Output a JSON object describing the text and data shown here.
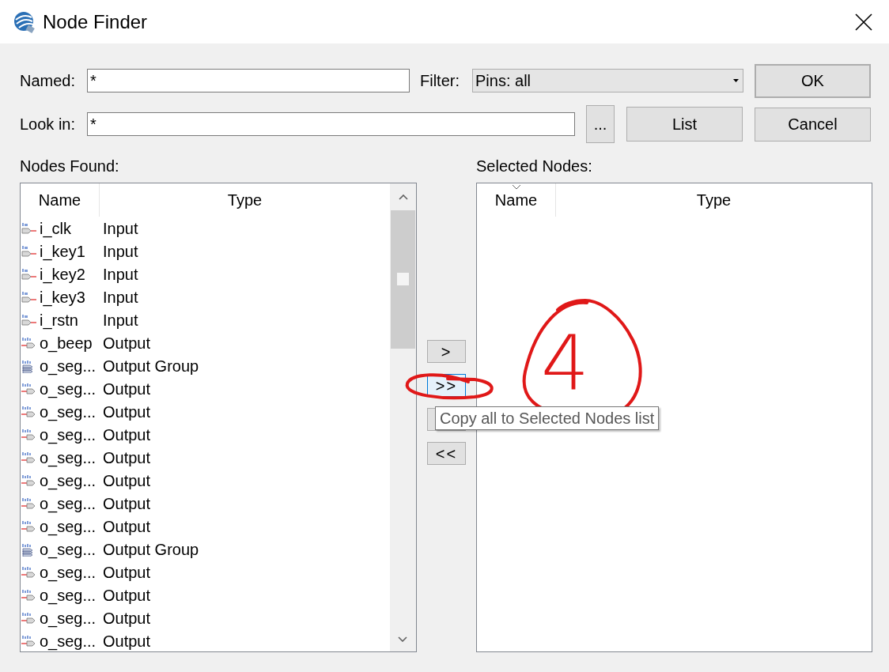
{
  "window": {
    "title": "Node Finder"
  },
  "named": {
    "label": "Named:",
    "value": "*"
  },
  "filter": {
    "label": "Filter:",
    "value": "Pins: all"
  },
  "look_in": {
    "label": "Look in:",
    "value": "*"
  },
  "buttons": {
    "browse": "...",
    "list": "List",
    "ok": "OK",
    "cancel": "Cancel"
  },
  "nodes_found": {
    "label": "Nodes Found:",
    "columns": [
      "Name",
      "Type"
    ],
    "rows": [
      {
        "name": "i_clk",
        "type": "Input",
        "kind": "input"
      },
      {
        "name": "i_key1",
        "type": "Input",
        "kind": "input"
      },
      {
        "name": "i_key2",
        "type": "Input",
        "kind": "input"
      },
      {
        "name": "i_key3",
        "type": "Input",
        "kind": "input"
      },
      {
        "name": "i_rstn",
        "type": "Input",
        "kind": "input"
      },
      {
        "name": "o_beep",
        "type": "Output",
        "kind": "output"
      },
      {
        "name": "o_seg...",
        "type": "Output Group",
        "kind": "group"
      },
      {
        "name": "o_seg...",
        "type": "Output",
        "kind": "output"
      },
      {
        "name": "o_seg...",
        "type": "Output",
        "kind": "output"
      },
      {
        "name": "o_seg...",
        "type": "Output",
        "kind": "output"
      },
      {
        "name": "o_seg...",
        "type": "Output",
        "kind": "output"
      },
      {
        "name": "o_seg...",
        "type": "Output",
        "kind": "output"
      },
      {
        "name": "o_seg...",
        "type": "Output",
        "kind": "output"
      },
      {
        "name": "o_seg...",
        "type": "Output",
        "kind": "output"
      },
      {
        "name": "o_seg...",
        "type": "Output Group",
        "kind": "group"
      },
      {
        "name": "o_seg...",
        "type": "Output",
        "kind": "output"
      },
      {
        "name": "o_seg...",
        "type": "Output",
        "kind": "output"
      },
      {
        "name": "o_seg...",
        "type": "Output",
        "kind": "output"
      },
      {
        "name": "o_seg...",
        "type": "Output",
        "kind": "output"
      }
    ]
  },
  "transfer_buttons": [
    {
      "label": ">",
      "hovered": false
    },
    {
      "label": ">>",
      "hovered": true
    },
    {
      "hovered": false
    },
    {
      "label": "<<",
      "hovered": false
    }
  ],
  "tooltip": "Copy all to Selected Nodes list",
  "selected_nodes": {
    "label": "Selected Nodes:",
    "columns": [
      "Name",
      "Type"
    ]
  },
  "annotation": {
    "label": "4"
  }
}
